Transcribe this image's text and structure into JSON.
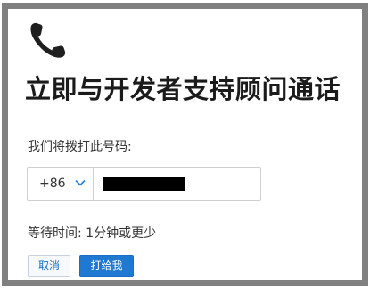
{
  "icons": {
    "header": "phone-icon",
    "country_code_dropdown": "chevron-down-icon"
  },
  "colors": {
    "primary_button": "#1f78d1",
    "link_text": "#1a73c8",
    "frame_border": "#808080"
  },
  "dialog": {
    "title": "立即与开发者支持顾问通话",
    "prompt": "我们将拨打此号码:",
    "phone": {
      "country_code": "+86",
      "number_redacted": true
    },
    "wait_time": "等待时间: 1分钟或更少",
    "buttons": {
      "cancel_label": "取消",
      "call_label": "打给我"
    }
  }
}
